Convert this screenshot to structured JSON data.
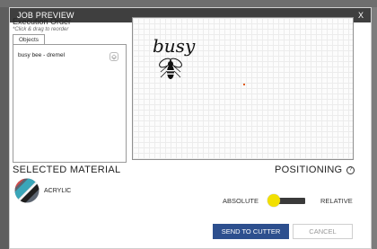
{
  "dialog": {
    "title": "JOB PREVIEW",
    "close_label": "X"
  },
  "execution": {
    "title": "Execution Order",
    "hint": "*Click & drag to reorder",
    "tab_label": "Objects",
    "items": [
      {
        "label": "busy bee - dremel",
        "icon": "layer-icon"
      }
    ]
  },
  "preview": {
    "artwork_text": "busy"
  },
  "material": {
    "heading": "SELECTED MATERIAL",
    "name": "ACRYLIC"
  },
  "positioning": {
    "heading": "POSITIONING",
    "help_icon": "help-circle-icon",
    "left_label": "ABSOLUTE",
    "right_label": "RELATIVE",
    "selected": "ABSOLUTE"
  },
  "actions": {
    "send_label": "SEND TO CUTTER",
    "cancel_label": "CANCEL"
  },
  "colors": {
    "titlebar": "#3f3f3f",
    "primary_button": "#2d4f8e",
    "toggle_knob": "#f2e000"
  }
}
